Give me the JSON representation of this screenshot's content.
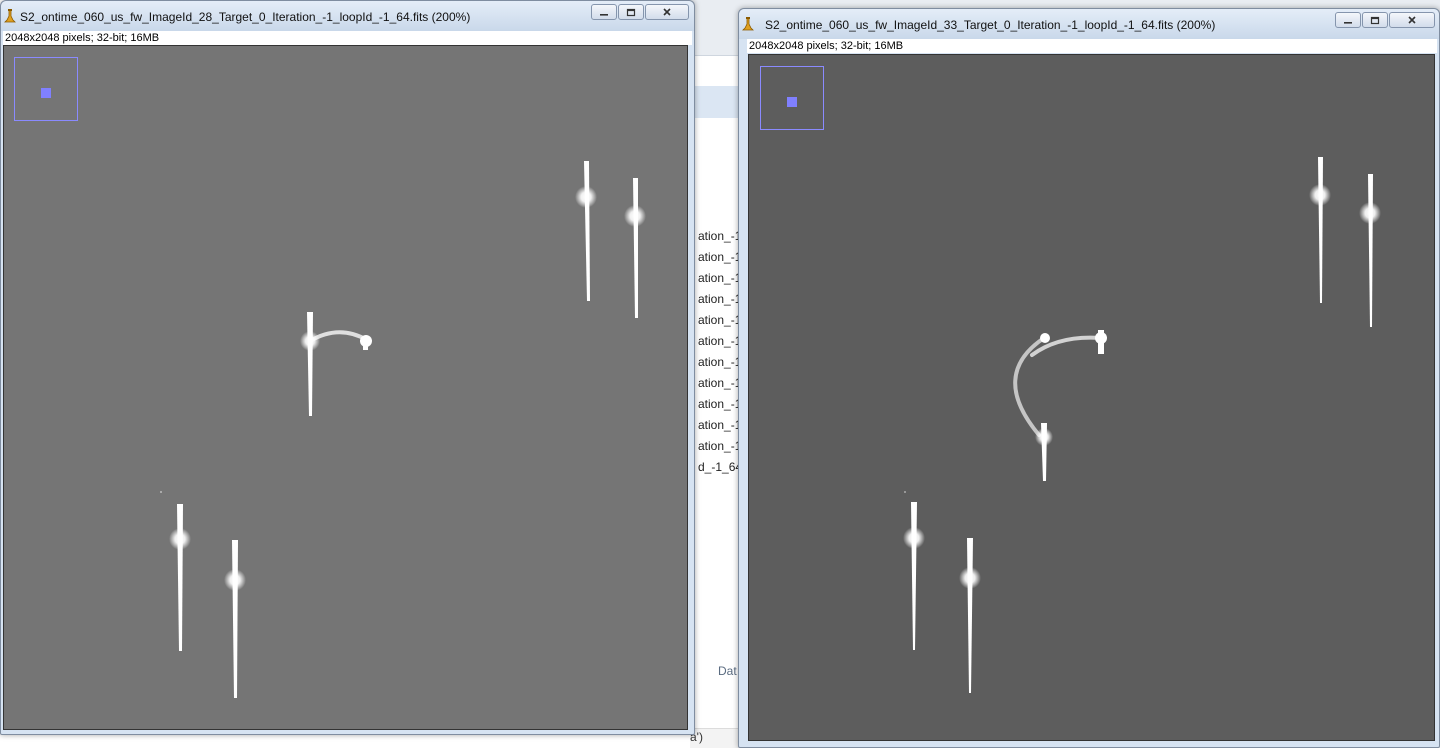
{
  "background_window": {
    "list_items": [
      "ation_-1",
      "ation_-1",
      "ation_-1",
      "ation_-1",
      "ation_-1",
      "ation_-1",
      "ation_-1",
      "ation_-1",
      "ation_-1",
      "ation_-1",
      "ation_-1",
      "d_-1_64"
    ],
    "dat_label": "Dat",
    "bottom_text": "a')"
  },
  "windows": [
    {
      "title": "S2_ontime_060_us_fw_ImageId_28_Target_0_Iteration_-1_loopId_-1_64.fits (200%)",
      "info": "2048x2048 pixels; 32-bit; 16MB",
      "canvas_bg": "#757575"
    },
    {
      "title": "S2_ontime_060_us_fw_ImageId_33_Target_0_Iteration_-1_loopId_-1_64.fits (200%)",
      "info": "2048x2048 pixels; 32-bit; 16MB",
      "canvas_bg": "#5d5d5d"
    }
  ],
  "icons": {
    "app": "imagej-microscope-icon",
    "minimize": "minimize-icon",
    "maximize": "maximize-icon",
    "close": "close-icon"
  },
  "colors": {
    "navigator": "#8080ff",
    "titlebar": "#d6e3f2"
  }
}
